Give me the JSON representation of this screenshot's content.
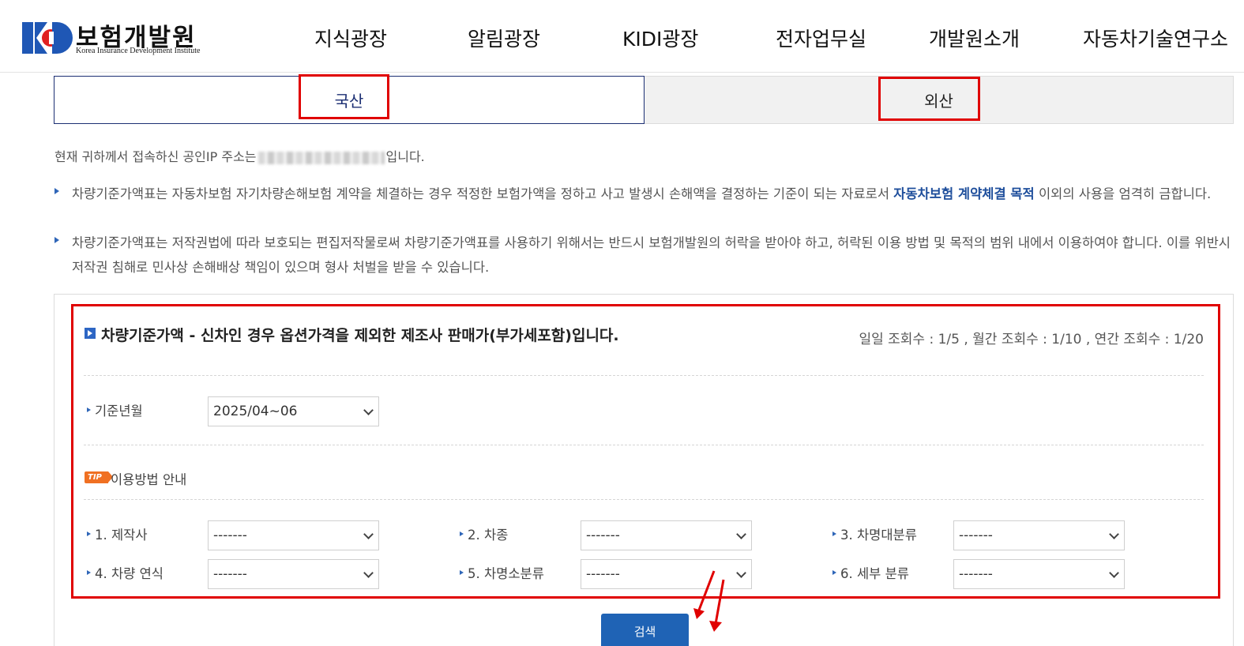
{
  "header": {
    "logo_korean": "보험개발원",
    "logo_english": "Korea Insurance Development Institute",
    "nav": [
      "지식광장",
      "알림광장",
      "KIDI광장",
      "전자업무실",
      "개발원소개",
      "자동차기술연구소"
    ]
  },
  "tabs": {
    "domestic": "국산",
    "foreign": "외산"
  },
  "ip_notice": {
    "prefix": "현재 귀하께서 접속하신 공인IP 주소는",
    "suffix": "입니다."
  },
  "notices": [
    {
      "before_link": "차량기준가액표는 자동차보험 자기차량손해보험 계약을 체결하는 경우 적정한 보험가액을 정하고 사고 발생시 손해액을 결정하는 기준이 되는 자료로서 ",
      "link": "자동차보험 계약체결 목적",
      "after_link": " 이외의 사용을 엄격히 금합니다."
    },
    {
      "before_link": "차량기준가액표는 저작권법에 따라 보호되는 편집저작물로써 차량기준가액표를 사용하기 위해서는 반드시 보험개발원의 허락을 받아야 하고, 허락된 이용 방법 및 목적의 범위 내에서 이용하여야 합니다. 이를 위반시 저작권 침해로 민사상 손해배상 책임이 있으며 형사 처벌을 받을 수 있습니다.",
      "link": "",
      "after_link": ""
    }
  ],
  "search": {
    "title": "차량기준가액 - 신차인 경우 옵션가격을 제외한 제조사 판매가(부가세포함)입니다.",
    "counts": "일일 조회수 : 1/5 , 월간 조회수 : 1/10 , 연간 조회수 : 1/20",
    "base_month_label": "기준년월",
    "base_month_value": "2025/04~06",
    "tip_badge": "TIP",
    "tip_text": "이용방법 안내",
    "fields": [
      {
        "label": "1. 제작사",
        "value": "-------"
      },
      {
        "label": "2. 차종",
        "value": "-------"
      },
      {
        "label": "3. 차명대분류",
        "value": "-------"
      },
      {
        "label": "4. 차량 연식",
        "value": "-------"
      },
      {
        "label": "5. 차명소분류",
        "value": "-------"
      },
      {
        "label": "6. 세부 분류",
        "value": "-------"
      }
    ],
    "button": "검색"
  },
  "colors": {
    "primary_navy": "#1c2f73",
    "button_blue": "#1f63b5",
    "highlight_red": "#e00000",
    "tip_orange": "#f07022"
  }
}
